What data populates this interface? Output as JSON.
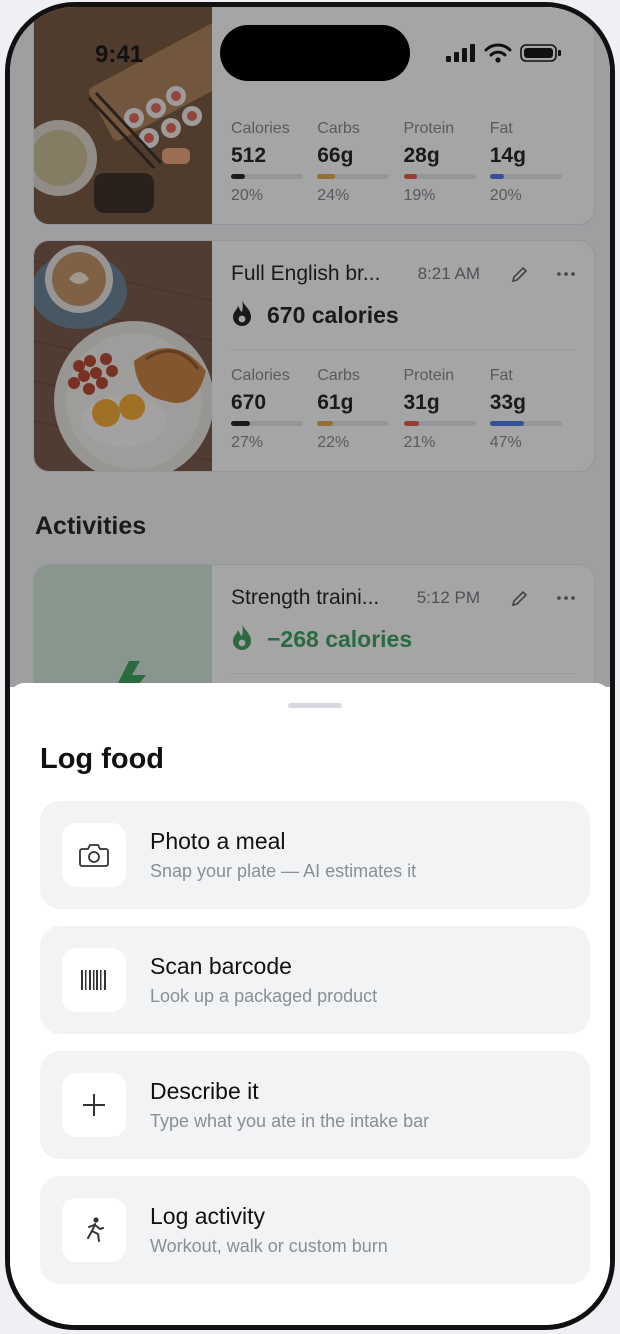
{
  "status_bar": {
    "time": "9:41"
  },
  "meals": [
    {
      "name": "",
      "time": "",
      "calories_label": "",
      "macros": [
        {
          "label": "Calories",
          "value": "512",
          "pct": "20%",
          "fill": 0.2,
          "color": "#111111"
        },
        {
          "label": "Carbs",
          "value": "66g",
          "pct": "24%",
          "fill": 0.24,
          "color": "#e6a23c"
        },
        {
          "label": "Protein",
          "value": "28g",
          "pct": "19%",
          "fill": 0.19,
          "color": "#e0503c"
        },
        {
          "label": "Fat",
          "value": "14g",
          "pct": "20%",
          "fill": 0.2,
          "color": "#3b6fe0"
        }
      ]
    },
    {
      "name": "Full English br...",
      "time": "8:21 AM",
      "calories_label": "670 calories",
      "macros": [
        {
          "label": "Calories",
          "value": "670",
          "pct": "27%",
          "fill": 0.27,
          "color": "#111111"
        },
        {
          "label": "Carbs",
          "value": "61g",
          "pct": "22%",
          "fill": 0.22,
          "color": "#e6a23c"
        },
        {
          "label": "Protein",
          "value": "31g",
          "pct": "21%",
          "fill": 0.21,
          "color": "#e0503c"
        },
        {
          "label": "Fat",
          "value": "33g",
          "pct": "47%",
          "fill": 0.47,
          "color": "#3b6fe0"
        }
      ]
    }
  ],
  "activities_title": "Activities",
  "activity": {
    "name": "Strength traini...",
    "time": "5:12 PM",
    "calories_label": "−268 calories",
    "accent": "#2e9a4e"
  },
  "sheet": {
    "title": "Log food",
    "options": [
      {
        "icon": "camera-icon",
        "title": "Photo a meal",
        "subtitle": "Snap your plate — AI estimates it"
      },
      {
        "icon": "barcode-icon",
        "title": "Scan barcode",
        "subtitle": "Look up a packaged product"
      },
      {
        "icon": "plus-icon",
        "title": "Describe it",
        "subtitle": "Type what you ate in the intake bar"
      },
      {
        "icon": "running-figure-icon",
        "title": "Log activity",
        "subtitle": "Workout, walk or custom burn"
      }
    ]
  }
}
